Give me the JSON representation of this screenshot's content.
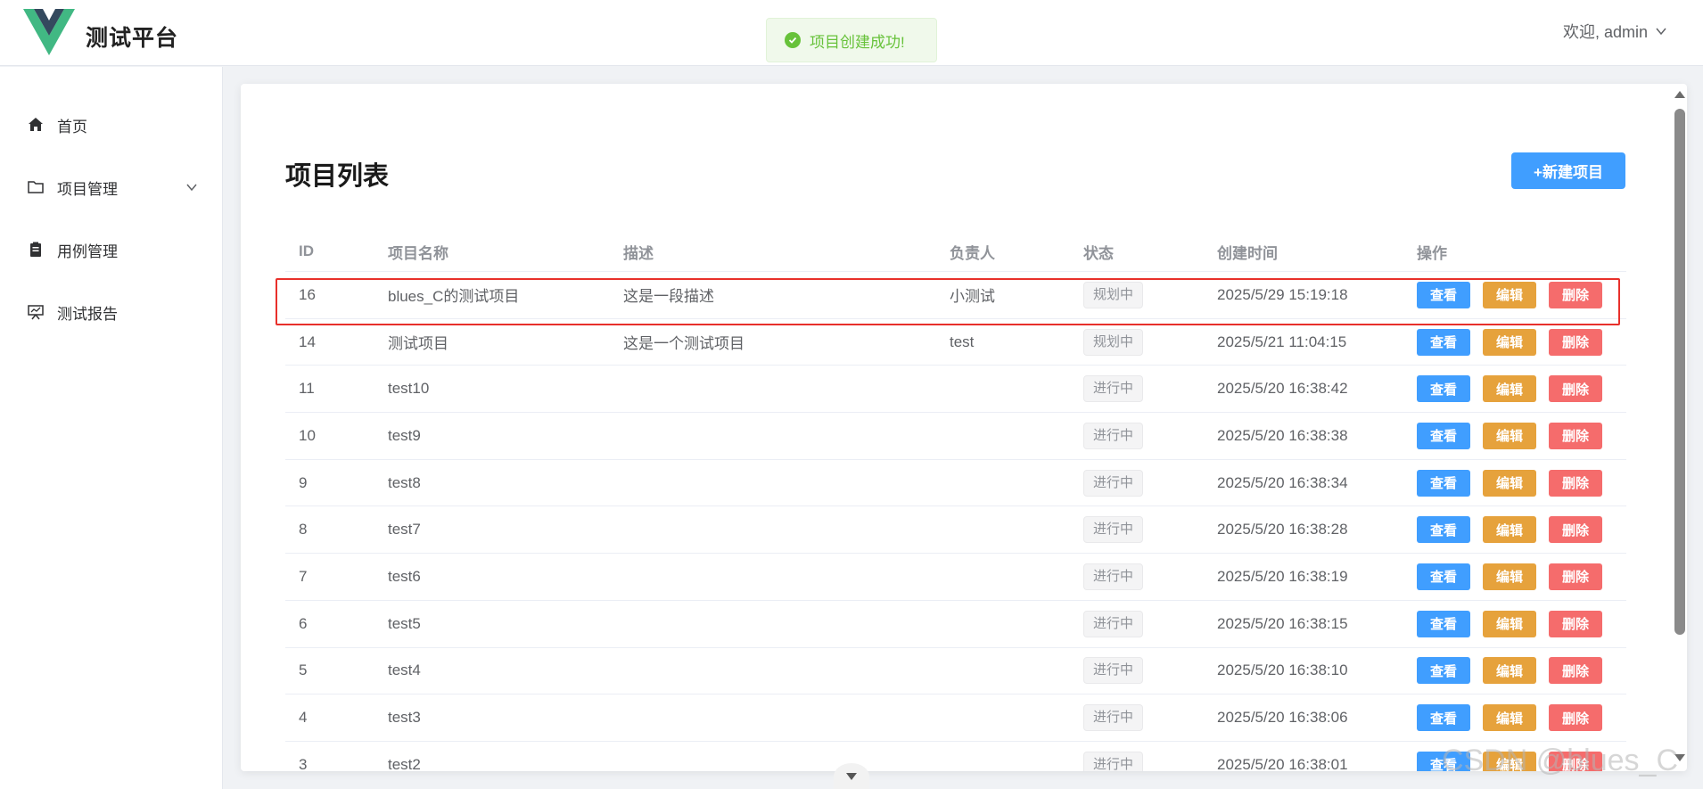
{
  "header": {
    "app_title": "测试平台",
    "user_menu": "欢迎, admin",
    "logo_colors": {
      "outer": "#41b883",
      "inner": "#34495e"
    }
  },
  "toast": {
    "message": "项目创建成功!",
    "type": "success",
    "icon": "check-circle-icon"
  },
  "sidebar": {
    "items": [
      {
        "label": "首页",
        "icon": "home-icon"
      },
      {
        "label": "项目管理",
        "icon": "folder-icon",
        "has_submenu": true
      },
      {
        "label": "用例管理",
        "icon": "clipboard-icon"
      },
      {
        "label": "测试报告",
        "icon": "presentation-icon"
      }
    ]
  },
  "main": {
    "title": "项目列表",
    "new_button": "+新建项目",
    "columns": [
      "ID",
      "项目名称",
      "描述",
      "负责人",
      "状态",
      "创建时间",
      "操作"
    ],
    "actions": {
      "view": "查看",
      "edit": "编辑",
      "delete": "删除"
    },
    "rows": [
      {
        "id": "16",
        "name": "blues_C的测试项目",
        "desc": "这是一段描述",
        "owner": "小测试",
        "status": "规划中",
        "created": "2025/5/29 15:19:18"
      },
      {
        "id": "14",
        "name": "测试项目",
        "desc": "这是一个测试项目",
        "owner": "test",
        "status": "规划中",
        "created": "2025/5/21 11:04:15"
      },
      {
        "id": "11",
        "name": "test10",
        "desc": "",
        "owner": "",
        "status": "进行中",
        "created": "2025/5/20 16:38:42"
      },
      {
        "id": "10",
        "name": "test9",
        "desc": "",
        "owner": "",
        "status": "进行中",
        "created": "2025/5/20 16:38:38"
      },
      {
        "id": "9",
        "name": "test8",
        "desc": "",
        "owner": "",
        "status": "进行中",
        "created": "2025/5/20 16:38:34"
      },
      {
        "id": "8",
        "name": "test7",
        "desc": "",
        "owner": "",
        "status": "进行中",
        "created": "2025/5/20 16:38:28"
      },
      {
        "id": "7",
        "name": "test6",
        "desc": "",
        "owner": "",
        "status": "进行中",
        "created": "2025/5/20 16:38:19"
      },
      {
        "id": "6",
        "name": "test5",
        "desc": "",
        "owner": "",
        "status": "进行中",
        "created": "2025/5/20 16:38:15"
      },
      {
        "id": "5",
        "name": "test4",
        "desc": "",
        "owner": "",
        "status": "进行中",
        "created": "2025/5/20 16:38:10"
      },
      {
        "id": "4",
        "name": "test3",
        "desc": "",
        "owner": "",
        "status": "进行中",
        "created": "2025/5/20 16:38:06"
      },
      {
        "id": "3",
        "name": "test2",
        "desc": "",
        "owner": "",
        "status": "进行中",
        "created": "2025/5/20 16:38:01"
      }
    ]
  },
  "watermark": "CSDN @blues_C"
}
